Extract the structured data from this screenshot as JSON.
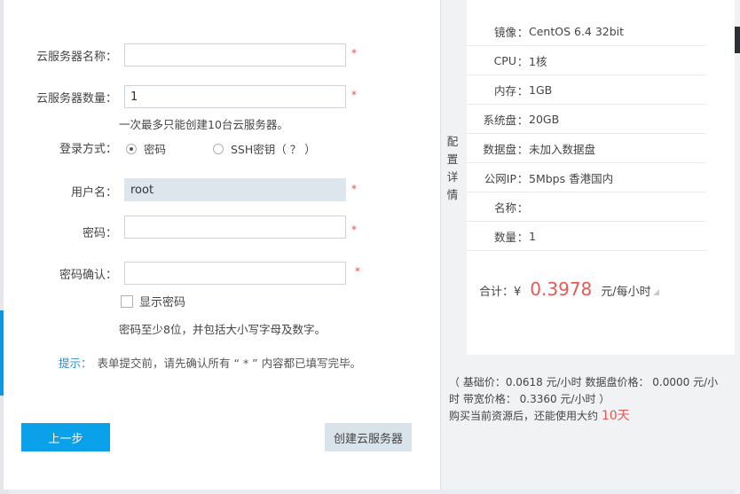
{
  "form": {
    "name_label": "云服务器名称：",
    "name_value": "",
    "count_label": "云服务器数量：",
    "count_value": "1",
    "count_hint": "一次最多只能创建10台云服务器。",
    "login_label": "登录方式：",
    "login_options": [
      "密码",
      "SSH密钥（ ？ ）"
    ],
    "login_selected": "密码",
    "user_label": "用户名：",
    "user_value": "root",
    "password_label": "密码：",
    "password_value": "",
    "confirm_label": "密码确认：",
    "confirm_value": "",
    "show_password_label": "显示密码",
    "show_password_checked": false,
    "password_rule": "密码至少8位，并包括大小写字母及数字。",
    "required_mark": "*",
    "tip_label": "提示：",
    "tip_text": "表单提交前，请先确认所有 “ * ” 内容都已填写完毕。"
  },
  "buttons": {
    "prev": "上一步",
    "create": "创建云服务器"
  },
  "detail": {
    "tab_label": "配置详情",
    "sep": "：",
    "specs": [
      {
        "key": "镜像",
        "value": "CentOS 6.4 32bit"
      },
      {
        "key": "CPU",
        "value": "1核"
      },
      {
        "key": "内存",
        "value": "1GB"
      },
      {
        "key": "系统盘",
        "value": "20GB"
      },
      {
        "key": "数据盘",
        "value": "未加入数据盘"
      },
      {
        "key": "公网IP",
        "value": "5Mbps 香港国内"
      },
      {
        "key": "名称",
        "value": ""
      },
      {
        "key": "数量",
        "value": "1"
      }
    ],
    "total_label": "合计：¥",
    "total_price": "0.3978",
    "total_unit": "元/每小时"
  },
  "pricing": {
    "line1": "（ 基础价：0.0618 元/小时   数据盘价格： 0.0000 元/小时   带宽价格： 0.3360 元/小时   ）",
    "line2_prefix": "购买当前资源后，还能使用大约",
    "days": "10天"
  },
  "colors": {
    "accent": "#0aa0ea",
    "price_red": "#e45a56",
    "tip_blue": "#2c8fd0"
  }
}
